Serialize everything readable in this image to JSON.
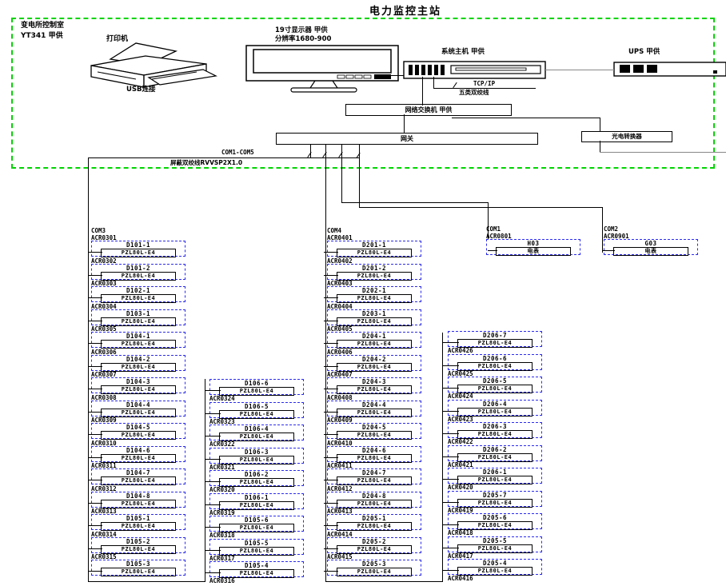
{
  "title": "电力监控主站",
  "room": {
    "name_line1": "变电所控制室",
    "name_line2": "YT341 甲供",
    "printer": "打印机",
    "usb": "USB连接",
    "monitor_line1": "19寸显示器   甲供",
    "monitor_line2": "分辨率1680-900",
    "host": "系统主机   甲供",
    "ups": "UPS   甲供",
    "tcpip": "TCP/IP",
    "cat5": "五类双绞线",
    "switch": "网络交换机 甲供",
    "gateway": "网关",
    "converter": "光电转换器"
  },
  "serial_bus": {
    "ports": "COM1-COM5",
    "cable": "屏蔽双绞线RVVSP2X1.0"
  },
  "device_model": "PZL80L-E4",
  "columns": [
    {
      "id": "com3",
      "port": "COM3",
      "cells": [
        [
          "ACR0301",
          "D101-1"
        ],
        [
          "ACR0302",
          "D101-2"
        ],
        [
          "ACR0303",
          "D102-1"
        ],
        [
          "ACR0304",
          "D103-1"
        ],
        [
          "ACR0305",
          "D104-1"
        ],
        [
          "ACR0306",
          "D104-2"
        ],
        [
          "ACR0307",
          "D104-3"
        ],
        [
          "ACR0308",
          "D104-4"
        ],
        [
          "ACR0309",
          "D104-5"
        ],
        [
          "ACR0310",
          "D104-6"
        ],
        [
          "ACR0311",
          "D104-7"
        ],
        [
          "ACR0312",
          "D104-8"
        ],
        [
          "ACR0313",
          "D105-1"
        ],
        [
          "ACR0314",
          "D105-2"
        ],
        [
          "ACR0315",
          "D105-3"
        ]
      ]
    },
    {
      "id": "mid1",
      "port": null,
      "cells": [
        [
          "ACR0324",
          "D106-6"
        ],
        [
          "ACR0323",
          "D106-5"
        ],
        [
          "ACR0322",
          "D106-4"
        ],
        [
          "ACR0321",
          "D106-3"
        ],
        [
          "ACR0320",
          "D106-2"
        ],
        [
          "ACR0319",
          "D106-1"
        ],
        [
          "ACR0318",
          "D105-6"
        ],
        [
          "ACR0317",
          "D105-5"
        ],
        [
          "ACR0316",
          "D105-4"
        ]
      ]
    },
    {
      "id": "com4",
      "port": "COM4",
      "cells": [
        [
          "ACR0401",
          "D201-1"
        ],
        [
          "ACR0402",
          "D201-2"
        ],
        [
          "ACR0403",
          "D202-1"
        ],
        [
          "ACR0404",
          "D203-1"
        ],
        [
          "ACR0405",
          "D204-1"
        ],
        [
          "ACR0406",
          "D204-2"
        ],
        [
          "ACR0407",
          "D204-3"
        ],
        [
          "ACR0408",
          "D204-4"
        ],
        [
          "ACR0409",
          "D204-5"
        ],
        [
          "ACR0410",
          "D204-6"
        ],
        [
          "ACR0411",
          "D204-7"
        ],
        [
          "ACR0412",
          "D204-8"
        ],
        [
          "ACR0413",
          "D205-1"
        ],
        [
          "ACR0414",
          "D205-2"
        ],
        [
          "ACR0415",
          "D205-3"
        ]
      ]
    },
    {
      "id": "mid2",
      "port": null,
      "cells": [
        [
          "ACR0426",
          "D206-7"
        ],
        [
          "ACR0425",
          "D206-6"
        ],
        [
          "ACR0424",
          "D206-5"
        ],
        [
          "ACR0423",
          "D206-4"
        ],
        [
          "ACR0422",
          "D206-3"
        ],
        [
          "ACR0421",
          "D206-2"
        ],
        [
          "ACR0420",
          "D206-1"
        ],
        [
          "ACR0419",
          "D205-7"
        ],
        [
          "ACR0418",
          "D205-6"
        ],
        [
          "ACR0417",
          "D205-5"
        ],
        [
          "ACR0416",
          "D205-4"
        ]
      ]
    },
    {
      "id": "com1",
      "port": "COM1",
      "cells": [
        [
          "ACR0801",
          "H03",
          "电表"
        ]
      ]
    },
    {
      "id": "com2",
      "port": "COM2",
      "cells": [
        [
          "ACR0901",
          "G03",
          "电表"
        ]
      ]
    }
  ]
}
